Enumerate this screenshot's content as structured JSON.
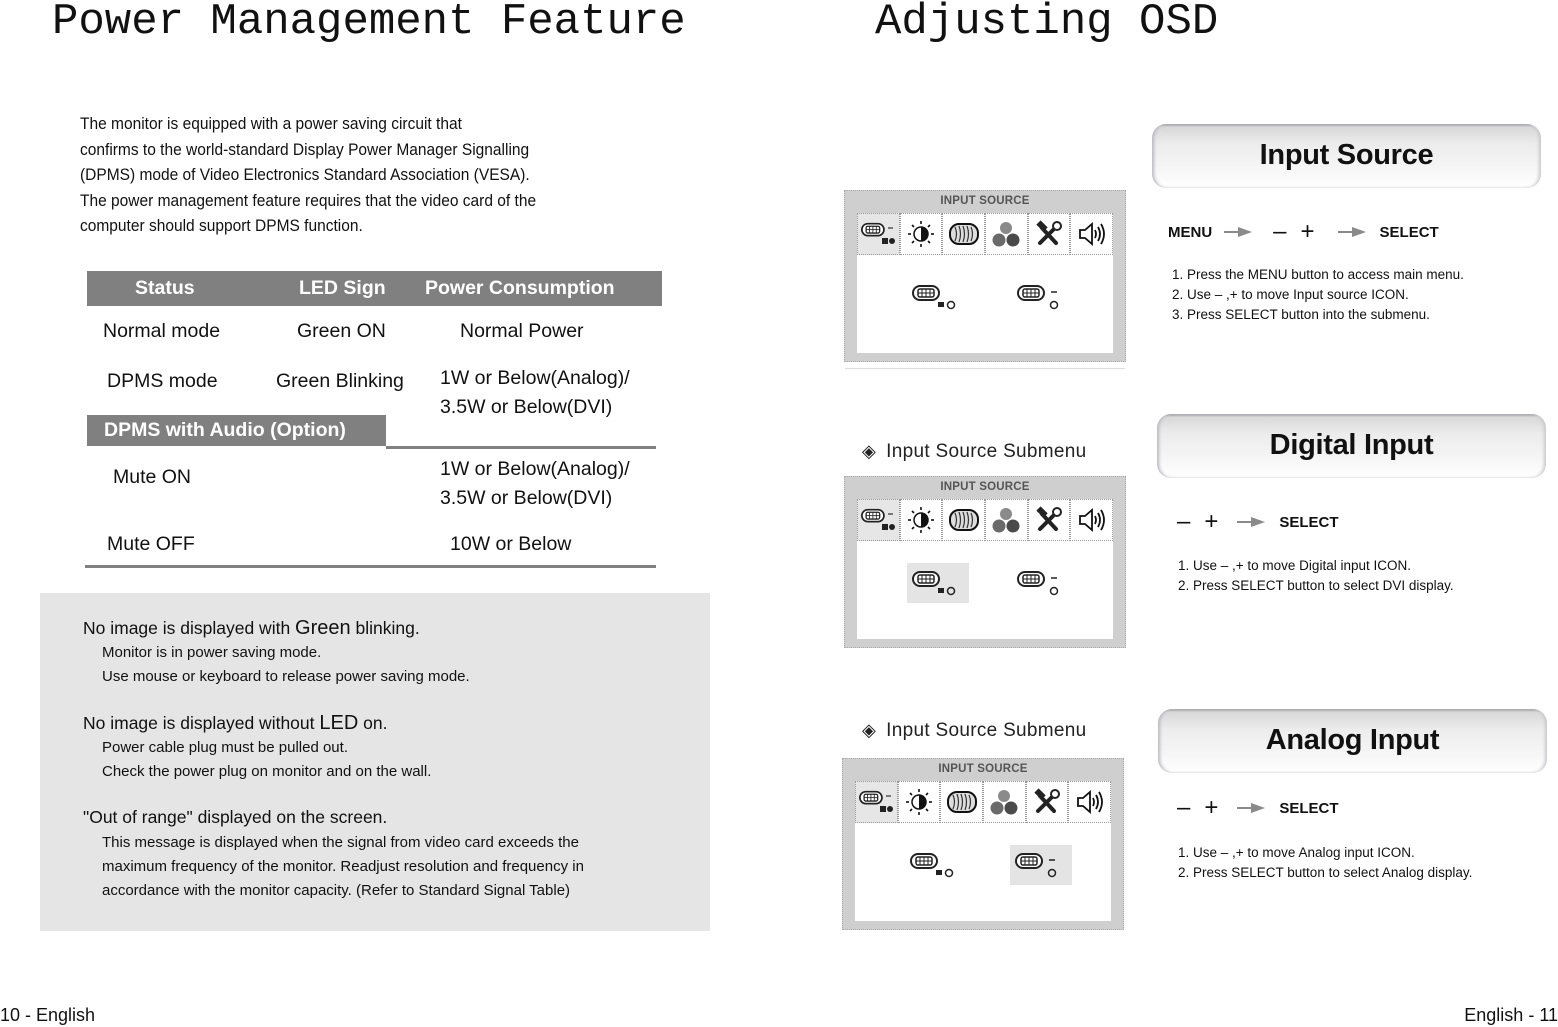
{
  "left_page": {
    "title": "Power Management Feature",
    "intro_lines": [
      "The monitor is equipped with a power saving circuit that",
      "confirms to the world-standard Display Power Manager Signalling",
      "(DPMS) mode of Video Electronics Standard Association (VESA).",
      "The power management feature requires that the video card of the",
      "computer should support DPMS function."
    ],
    "table": {
      "headers": [
        "Status",
        "LED Sign",
        "Power Consumption"
      ],
      "rows": [
        {
          "status": "Normal mode",
          "led": "Green ON",
          "power": [
            "Normal Power"
          ]
        },
        {
          "status": "DPMS mode",
          "led": "Green Blinking",
          "power": [
            "1W or Below(Analog)/",
            "3.5W or Below(DVI)"
          ]
        }
      ],
      "audio_section_label": "DPMS with Audio (Option)",
      "audio_rows": [
        {
          "status": "Mute ON",
          "led": "",
          "power": [
            "1W or Below(Analog)/",
            "3.5W or Below(DVI)"
          ]
        },
        {
          "status": "Mute OFF",
          "led": "",
          "power": [
            "10W or Below"
          ]
        }
      ]
    },
    "troubleshooting": [
      {
        "heading_pre": "No image is displayed with ",
        "heading_emph": "Green",
        "heading_post": " blinking.",
        "lines": [
          "Monitor is in power saving mode.",
          "Use mouse or keyboard to release power saving mode."
        ]
      },
      {
        "heading_pre": "No image is displayed without ",
        "heading_emph": "LED",
        "heading_post": " on.",
        "lines": [
          "Power cable plug must be pulled out.",
          "Check the power plug on monitor and on the wall."
        ]
      },
      {
        "heading_pre": "\"Out of range\" displayed on the screen.",
        "heading_emph": "",
        "heading_post": "",
        "lines": [
          "This message is displayed when the signal from video card exceeds the",
          "maximum frequency of the monitor. Readjust resolution and frequency in",
          "accordance with the monitor capacity. (Refer to Standard Signal Table)"
        ]
      }
    ],
    "footer": "10 - English"
  },
  "right_page": {
    "title": "Adjusting OSD",
    "osd_screens": [
      {
        "title": "INPUT SOURCE",
        "tabs": [
          "input-source",
          "brightness-contrast",
          "image",
          "color",
          "setup",
          "audio"
        ],
        "active_tab": 0,
        "selected_option": null
      },
      {
        "title": "INPUT SOURCE",
        "tabs": [
          "input-source",
          "brightness-contrast",
          "image",
          "color",
          "setup",
          "audio"
        ],
        "active_tab": 0,
        "selected_option": "digital"
      },
      {
        "title": "INPUT SOURCE",
        "tabs": [
          "input-source",
          "brightness-contrast",
          "image",
          "color",
          "setup",
          "audio"
        ],
        "active_tab": 0,
        "selected_option": "analog"
      }
    ],
    "submenu_label": "Input Source Submenu",
    "sections": [
      {
        "header": "Input Source",
        "flow": {
          "menu": "MENU",
          "minus": "–",
          "plus": "+",
          "select": "SELECT"
        },
        "steps": [
          "1. Press the MENU button to access main menu.",
          "2. Use  – ,+ to move Input source ICON.",
          "3. Press SELECT button into the submenu."
        ]
      },
      {
        "header": "Digital Input",
        "flow": {
          "minus": "–",
          "plus": "+",
          "select": "SELECT"
        },
        "steps": [
          "1. Use  – ,+ to move Digital input ICON.",
          "2. Press SELECT button to select DVI display."
        ]
      },
      {
        "header": "Analog Input",
        "flow": {
          "minus": "–",
          "plus": "+",
          "select": "SELECT"
        },
        "steps": [
          "1. Use  – ,+ to move Analog input ICON.",
          "2. Press SELECT button to select Analog display."
        ]
      }
    ],
    "footer": "English - 11"
  },
  "colors": {
    "table_header_bg": "#808080",
    "trouble_bg": "#e5e5e5",
    "osd_frame_bg": "#cfcfcf",
    "arrow_gray": "#8a8a8a"
  }
}
